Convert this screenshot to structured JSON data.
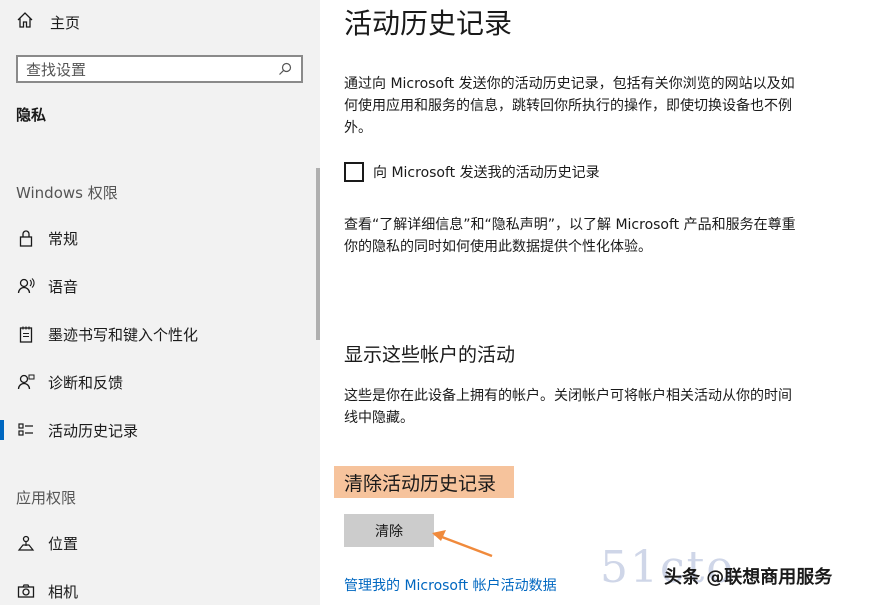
{
  "sidebar": {
    "home_label": "主页",
    "search_placeholder": "查找设置",
    "section_title": "隐私",
    "groups": [
      {
        "title": "Windows 权限",
        "items": [
          {
            "label": "常规",
            "icon": "lock-icon"
          },
          {
            "label": "语音",
            "icon": "speech-icon"
          },
          {
            "label": "墨迹书写和键入个性化",
            "icon": "notepad-icon"
          },
          {
            "label": "诊断和反馈",
            "icon": "feedback-icon"
          },
          {
            "label": "活动历史记录",
            "icon": "activity-icon",
            "selected": true
          }
        ]
      },
      {
        "title": "应用权限",
        "items": [
          {
            "label": "位置",
            "icon": "location-icon"
          },
          {
            "label": "相机",
            "icon": "camera-icon"
          }
        ]
      }
    ]
  },
  "main": {
    "title": "活动历史记录",
    "intro": "通过向 Microsoft 发送你的活动历史记录，包括有关你浏览的网站以及如何使用应用和服务的信息，跳转回你所执行的操作，即使切换设备也不例外。",
    "checkbox_label": "向 Microsoft 发送我的活动历史记录",
    "checkbox_checked": false,
    "privacy_text": "查看“了解详细信息”和“隐私声明”，以了解 Microsoft 产品和服务在尊重你的隐私的同时如何使用此数据提供个性化体验。",
    "accounts_title": "显示这些帐户的活动",
    "accounts_text": "这些是你在此设备上拥有的帐户。关闭帐户可将帐户相关活动从你的时间线中隐藏。",
    "clear_title": "清除活动历史记录",
    "clear_button": "清除",
    "manage_link": "管理我的 Microsoft 帐户活动数据"
  },
  "overlay": {
    "watermark": "头条 @联想商用服务",
    "watermark_bg": "51cto",
    "highlight_color": "#f6c39c",
    "arrow_color": "#f08a3c"
  },
  "colors": {
    "accent": "#0067c0",
    "sidebar_bg": "#f2f2f2"
  }
}
